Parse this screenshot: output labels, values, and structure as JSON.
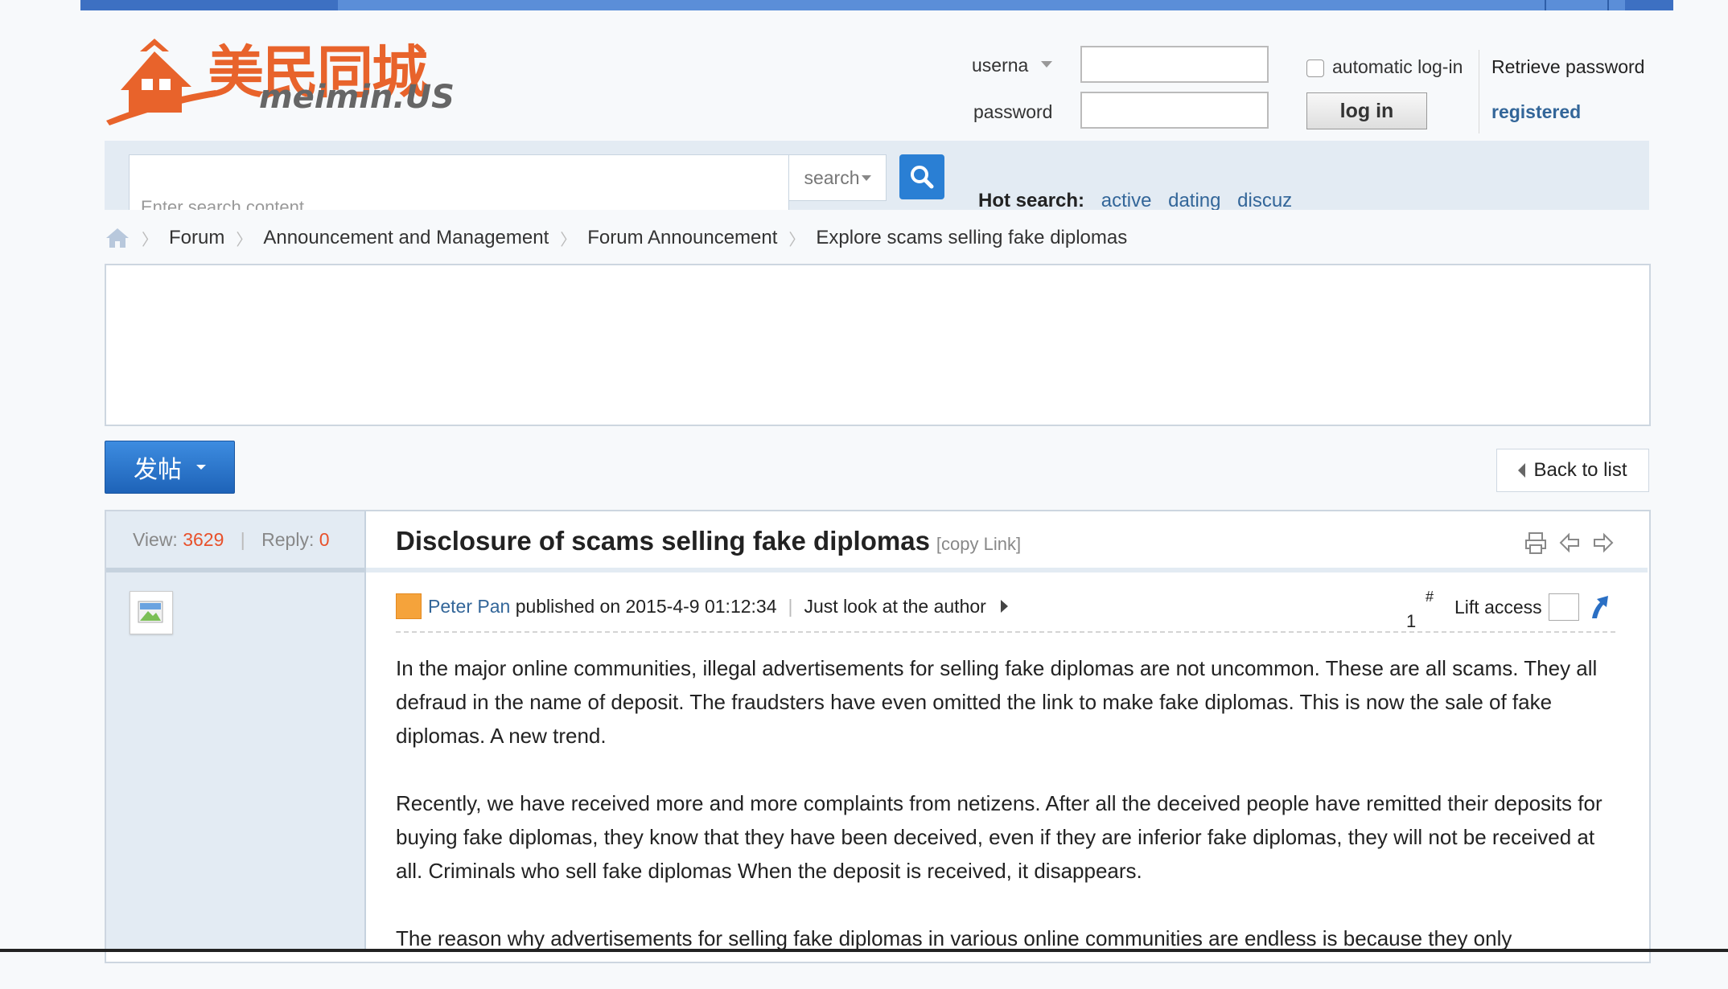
{
  "logo": {
    "cn": "美民同城",
    "en": "meimin.US"
  },
  "login": {
    "username_label": "userna",
    "password_label": "password",
    "auto_login_label": "automatic log-in",
    "retrieve_password": "Retrieve password",
    "login_button": "log in",
    "register_link": "registered"
  },
  "search": {
    "placeholder": "Enter search content",
    "type_label": "search",
    "hot_label": "Hot search:",
    "hot_items": [
      "active",
      "dating",
      "discuz"
    ]
  },
  "breadcrumb": [
    "Forum",
    "Announcement and Management",
    "Forum Announcement",
    "Explore scams selling fake diplomas"
  ],
  "post_button": "发帖",
  "back_to_list": "Back to list",
  "stats": {
    "view_label": "View:",
    "view_count": "3629",
    "reply_label": "Reply:",
    "reply_count": "0"
  },
  "post": {
    "title": "Disclosure of scams selling fake diplomas",
    "copy_link": "[copy Link]",
    "author": "Peter Pan",
    "published": "published on 2015-4-9 01:12:34",
    "author_only": "Just look at the author",
    "floor_hash": "#",
    "floor_num": "1",
    "lift_access": "Lift access",
    "paragraphs": [
      "In the major online communities, illegal advertisements for selling fake diplomas are not uncommon. These are all scams. They all defraud in the name of deposit. The fraudsters have even omitted the link to make fake diplomas. This is now the sale of fake diplomas. A new trend.",
      "Recently, we have received more and more complaints from netizens. After all the deceived people have remitted their deposits for buying fake diplomas, they know that they have been deceived, even if they are inferior fake diplomas, they will not be received at all. Criminals who sell fake diplomas When the deposit is received, it disappears.",
      "The reason why advertisements for selling fake diplomas in various online communities are endless is because they only"
    ]
  },
  "colors": {
    "brand": "#e8632b",
    "link": "#336699",
    "accent_blue": "#2a7fd4",
    "count": "#e8512b"
  }
}
